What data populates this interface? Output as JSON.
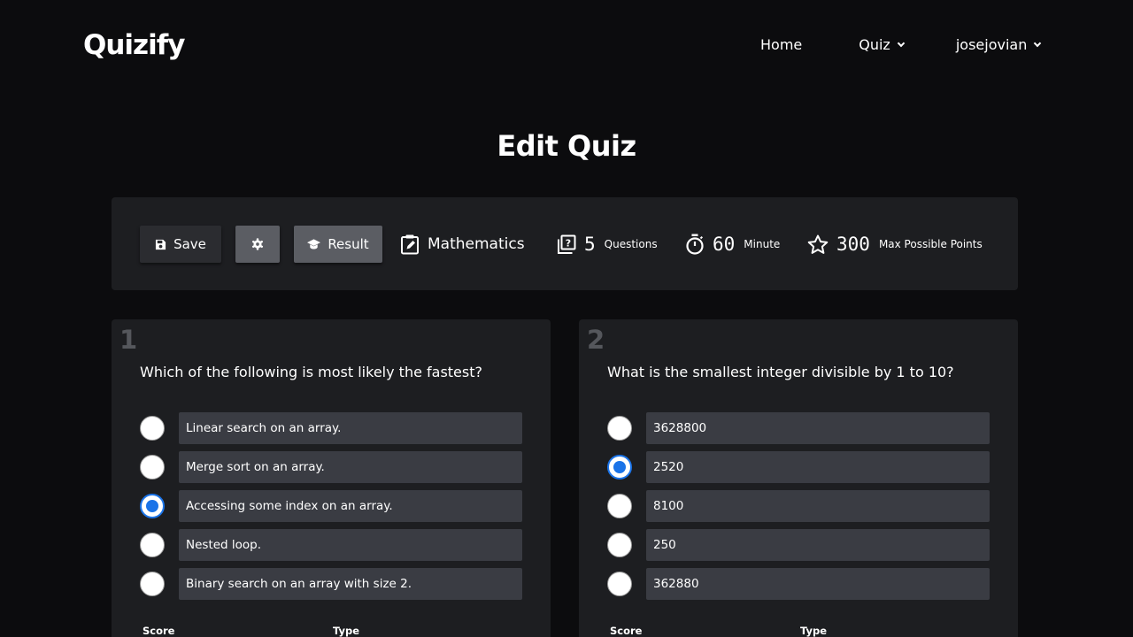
{
  "nav": {
    "brand": "Quizify",
    "links": [
      {
        "label": "Home"
      },
      {
        "label": "Quiz"
      },
      {
        "label": "josejovian"
      }
    ]
  },
  "page_title": "Edit Quiz",
  "toolbar": {
    "save_label": "Save",
    "result_label": "Result",
    "subject": "Mathematics",
    "questions_count": "5",
    "questions_label": "Questions",
    "minutes_count": "60",
    "minutes_label": "Minute",
    "points_count": "300",
    "points_label": "Max Possible Points"
  },
  "questions": [
    {
      "number": "1",
      "text": "Which of the following is most likely the fastest?",
      "selected_index": 2,
      "options": [
        "Linear search on an array.",
        "Merge sort on an array.",
        "Accessing some index on an array.",
        "Nested loop.",
        "Binary search on an array with size 2."
      ],
      "score_label": "Score",
      "type_label": "Type"
    },
    {
      "number": "2",
      "text": "What is the smallest integer divisible by 1 to 10?",
      "selected_index": 1,
      "options": [
        "3628800",
        "2520",
        "8100",
        "250",
        "362880"
      ],
      "score_label": "Score",
      "type_label": "Type"
    }
  ],
  "colors": {
    "background": "#0c0c0e",
    "panel": "#1d1e21",
    "input": "#3a3c43",
    "accent": "#1a73e8"
  }
}
